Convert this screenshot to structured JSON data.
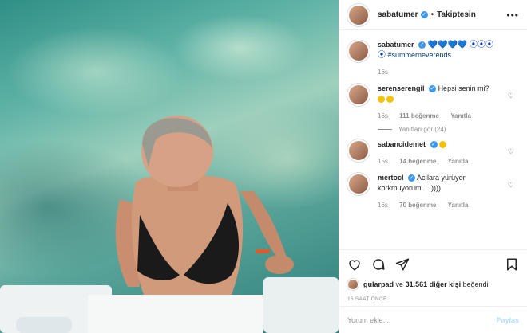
{
  "post": {
    "username": "sabatumer",
    "follow_status": "Takiptesin",
    "more_label": "•••"
  },
  "caption": {
    "username": "sabatumer",
    "hearts": "💙💙💙💙",
    "hashtag": "#summerneverends",
    "time": "16s"
  },
  "comments": [
    {
      "username": "serenserengil",
      "text": "Hepsi senin mi?",
      "time": "16s",
      "likes": "111 beğenme",
      "reply": "Yanıtla",
      "view_replies": "Yanıtları gör (24)"
    },
    {
      "username": "sabancidemet",
      "text": "",
      "time": "15s",
      "likes": "14 beğenme",
      "reply": "Yanıtla"
    },
    {
      "username": "mertocl",
      "text": "Acılara yürüyor korkmuyorum ... ))))",
      "time": "16s",
      "likes": "70 beğenme",
      "reply": "Yanıtla"
    }
  ],
  "likes": {
    "user": "gularpad",
    "middle": "ve",
    "count": "31.561 diğer kişi",
    "suffix": "beğendi"
  },
  "timestamp": "16 SAAT ÖNCE",
  "add_comment": {
    "placeholder": "Yorum ekle...",
    "post_label": "Paylaş"
  }
}
